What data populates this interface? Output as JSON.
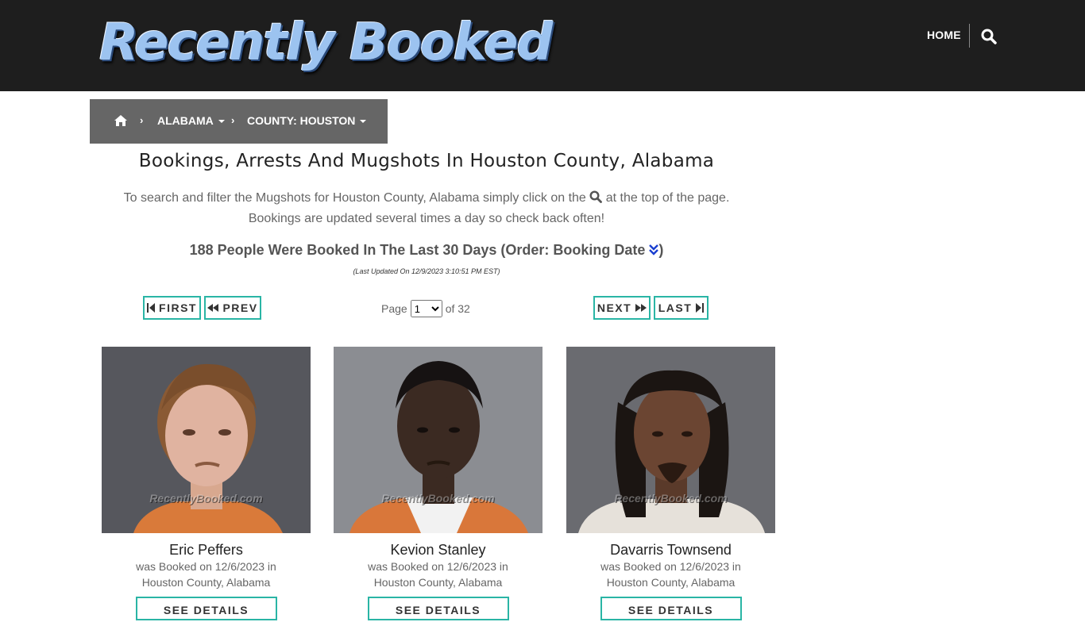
{
  "header": {
    "logo_text": "Recently Booked",
    "nav_home": "HOME",
    "search_icon": "search-icon"
  },
  "breadcrumb": {
    "home_icon": "home-icon",
    "state": "ALABAMA",
    "county": "COUNTY: HOUSTON"
  },
  "main": {
    "title": "Bookings, Arrests And Mugshots In Houston County, Alabama",
    "intro_before": "To search and filter the Mugshots for Houston County, Alabama simply click on the",
    "intro_after": "at the top of the page.",
    "intro_line2": "Bookings are updated several times a day so check back often!",
    "count_text": "188 People Were Booked In The Last 30 Days (Order: Booking Date",
    "count_close": ")",
    "updated": "(Last Updated On 12/9/2023 3:10:51 PM EST)"
  },
  "pagination": {
    "first": "FIRST",
    "prev": "PREV",
    "next": "NEXT",
    "last": "LAST",
    "page_label": "Page",
    "page_value": "1",
    "of_label": "of 32"
  },
  "bookings": [
    {
      "name": "Eric Peffers",
      "line1": "was Booked on 12/6/2023 in",
      "line2": "Houston County, Alabama",
      "button": "SEE DETAILS",
      "watermark": "RecentlyBooked.com"
    },
    {
      "name": "Kevion Stanley",
      "line1": "was Booked on 12/6/2023 in",
      "line2": "Houston County, Alabama",
      "button": "SEE DETAILS",
      "watermark": "RecentlyBooked.com"
    },
    {
      "name": "Davarris Townsend",
      "line1": "was Booked on 12/6/2023 in",
      "line2": "Houston County, Alabama",
      "button": "SEE DETAILS",
      "watermark": "RecentlyBooked.com"
    }
  ],
  "colors": {
    "header_bg": "#1e1e1e",
    "breadcrumb_bg": "#666666",
    "accent": "#2ab5a5"
  }
}
